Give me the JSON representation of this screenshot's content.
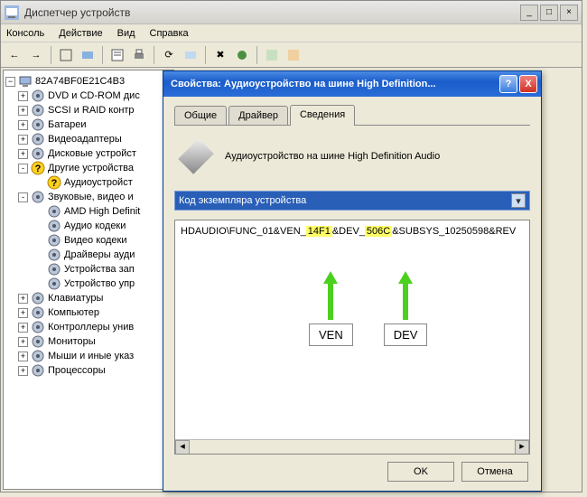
{
  "main_window": {
    "title": "Диспетчер устройств"
  },
  "menubar": {
    "console": "Консоль",
    "action": "Действие",
    "view": "Вид",
    "help": "Справка"
  },
  "tree": {
    "root": "82A74BF0E21C4B3",
    "items": [
      {
        "label": "DVD и CD-ROM дис",
        "exp": "+"
      },
      {
        "label": "SCSI и RAID контр",
        "exp": "+"
      },
      {
        "label": "Батареи",
        "exp": "+"
      },
      {
        "label": "Видеоадаптеры",
        "exp": "+"
      },
      {
        "label": "Дисковые устройст",
        "exp": "+"
      },
      {
        "label": "Другие устройства",
        "exp": "-",
        "warn": true
      },
      {
        "label": "Аудиоустройст",
        "child": true,
        "warn": true
      },
      {
        "label": "Звуковые, видео и",
        "exp": "-"
      },
      {
        "label": "AMD High Definit",
        "child": true
      },
      {
        "label": "Аудио кодеки",
        "child": true
      },
      {
        "label": "Видео кодеки",
        "child": true
      },
      {
        "label": "Драйверы ауди",
        "child": true
      },
      {
        "label": "Устройства зап",
        "child": true
      },
      {
        "label": "Устройство упр",
        "child": true
      },
      {
        "label": "Клавиатуры",
        "exp": "+"
      },
      {
        "label": "Компьютер",
        "exp": "+"
      },
      {
        "label": "Контроллеры унив",
        "exp": "+"
      },
      {
        "label": "Мониторы",
        "exp": "+"
      },
      {
        "label": "Мыши и иные указ",
        "exp": "+"
      },
      {
        "label": "Процессоры",
        "exp": "+"
      }
    ]
  },
  "dialog": {
    "title": "Свойства: Аудиоустройство на шине High Definition...",
    "tabs": {
      "general": "Общие",
      "driver": "Драйвер",
      "details": "Сведения"
    },
    "device_name": "Аудиоустройство на шине High Definition Audio",
    "dropdown_label": "Код экземпляра устройства",
    "hw_prefix": "HDAUDIO\\FUNC_01&VEN_",
    "hw_ven": "14F1",
    "hw_mid": "&DEV_",
    "hw_dev": "506C",
    "hw_suffix": "&SUBSYS_10250598&REV",
    "ann_ven": "VEN",
    "ann_dev": "DEV",
    "ok": "OK",
    "cancel": "Отмена"
  }
}
